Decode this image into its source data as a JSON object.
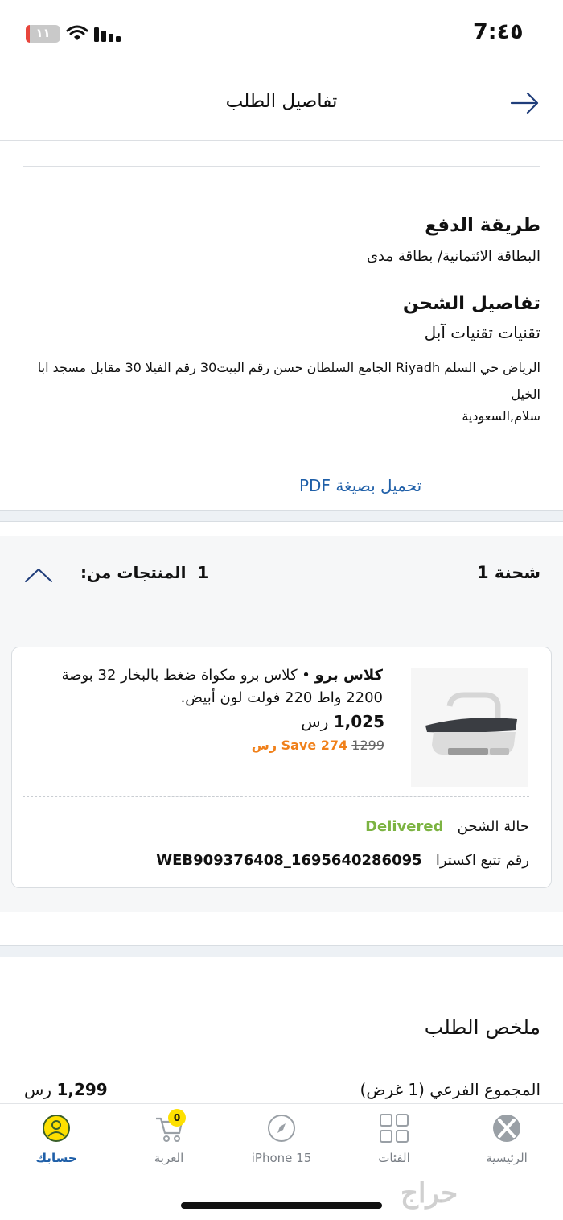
{
  "status_bar": {
    "time": "7:٤٥",
    "battery": "١١",
    "battery_fraction": 0.11
  },
  "header": {
    "title": "تفاصيل الطلب"
  },
  "payment": {
    "heading": "طريقة الدفع",
    "value": "البطاقة الائتمانية/ بطاقة مدى"
  },
  "shipping": {
    "heading": "تفاصيل الشحن",
    "name": "تقنيات تقنيات آبل",
    "address": "الرياض حي السلم Riyadh الجامع السلطان حسن رقم البيت30 رقم الفيلا 30 مقابل مسجد ابا الخيل",
    "country": "سلام,السعودية"
  },
  "pdf_link": "تحميل بصيغة PDF",
  "shipment": {
    "title": "شحنة 1",
    "products_label": "المنتجات من:",
    "products_count": "1",
    "product": {
      "brand": "كلاس برو",
      "separator": " • ",
      "description": "كلاس برو مكواة ضغط بالبخار 32 بوصة 2200 واط 220 فولت  لون أبيض.",
      "price": "1,025",
      "currency": "رس",
      "old_price": "1299",
      "save": "Save 274 رس"
    },
    "delivery_label": "حالة الشحن",
    "delivery_status": "Delivered",
    "tracking_label": "رقم تتبع اكسترا",
    "tracking_number": "WEB909376408_1695640286095"
  },
  "summary": {
    "title": "ملخص الطلب",
    "subtotal_label": "المجموع الفرعي (1 غرض)",
    "subtotal_value": "1,299",
    "currency": "رس"
  },
  "nav": {
    "account": "حسابك",
    "cart": "العربة",
    "cart_count": "0",
    "iphone": "iPhone 15",
    "categories": "الفئات",
    "home": "الرئيسية"
  },
  "watermark": "حراج",
  "colors": {
    "accent": "#1f5fa8",
    "delivered": "#7cb342",
    "save": "#f0801a",
    "badge": "#fde000"
  }
}
